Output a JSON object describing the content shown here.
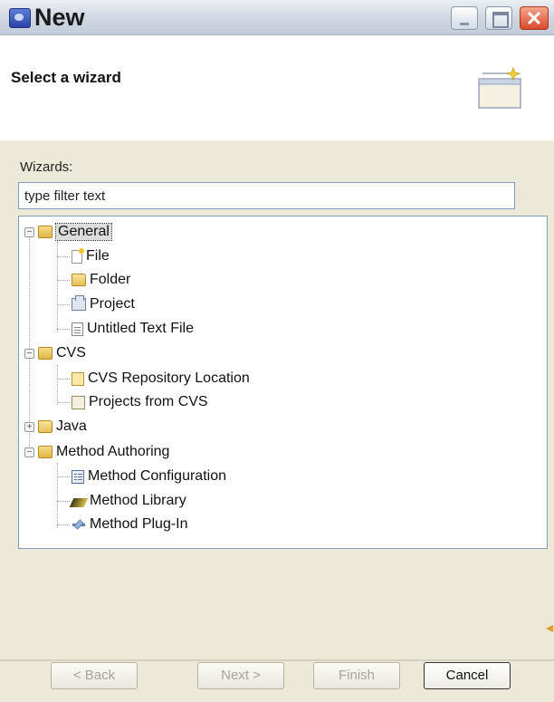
{
  "window": {
    "title": "New"
  },
  "header": {
    "title": "Select a wizard"
  },
  "wizards": {
    "label": "Wizards:",
    "filter_value": "type filter text"
  },
  "tree": {
    "general": {
      "label": "General",
      "children": [
        "File",
        "Folder",
        "Project",
        "Untitled Text File"
      ]
    },
    "cvs": {
      "label": "CVS",
      "children": [
        "CVS Repository Location",
        "Projects from CVS"
      ]
    },
    "java": {
      "label": "Java"
    },
    "method_authoring": {
      "label": "Method Authoring",
      "children": [
        "Method Configuration",
        "Method Library",
        "Method Plug-In"
      ]
    }
  },
  "buttons": {
    "back": "< Back",
    "next": "Next >",
    "finish": "Finish",
    "cancel": "Cancel"
  },
  "colors": {
    "window_bg": "#ece9d8",
    "close_button": "#d94a2b"
  }
}
